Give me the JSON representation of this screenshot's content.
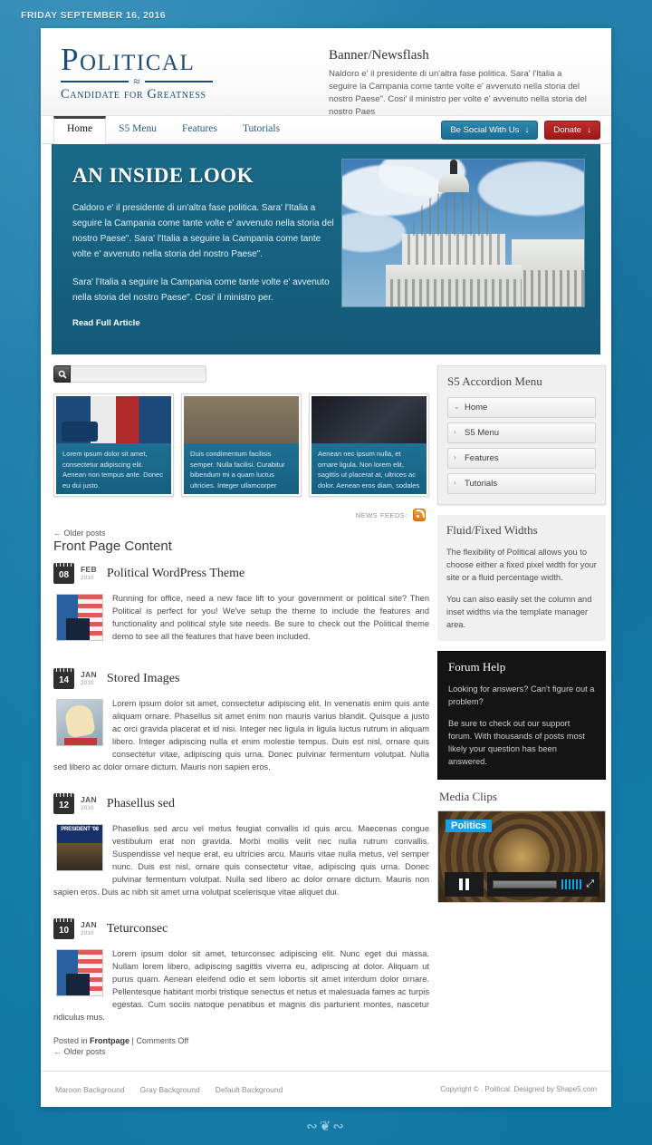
{
  "topbar": {
    "date": "FRIDAY SEPTEMBER 16, 2016"
  },
  "header": {
    "logo_main": "Political",
    "logo_sub": "Candidate for Greatness",
    "newsflash_title": "Banner/Newsflash",
    "newsflash_text": "Naldoro e' il presidente di un'altra fase politica. Sara' l'Italia a seguire la Campania come tante volte e' avvenuto nella storia del nostro Paese\". Cosi' il ministro per volte e' avvenuto nella storia del nostro Paes"
  },
  "nav": {
    "items": [
      {
        "label": "Home",
        "active": true
      },
      {
        "label": "S5 Menu",
        "active": false
      },
      {
        "label": "Features",
        "active": false
      },
      {
        "label": "Tutorials",
        "active": false
      }
    ],
    "social_button": "Be Social With Us",
    "donate_button": "Donate",
    "arrow_glyph": "↓"
  },
  "hero": {
    "title": "AN INSIDE LOOK",
    "paragraph1": "Caldoro e' il presidente di un'altra fase politica. Sara' l'Italia a seguire la Campania come tante volte e' avvenuto nella storia del nostro Paese\". Sara' l'Italia a seguire la Campania come tante volte e' avvenuto nella storia del nostro Paese\".",
    "paragraph2": "Sara' l'Italia a seguire la Campania come tante volte e' avvenuto nella storia del nostro Paese\". Cosi' il ministro per.",
    "link": "Read Full Article",
    "image_alt": "us-capitol-dome-photo"
  },
  "search": {
    "placeholder": "",
    "value": "",
    "icon": "search-icon"
  },
  "cards": [
    {
      "caption": "Lorem ipsum dolor sit amet, consectetur adipiscing elit. Aenean non tempus ante. Donec eu dui justo.",
      "image_alt": "press-conference-photo"
    },
    {
      "caption": "Duis condimentum facilisis semper. Nulla facilisi. Curabitur bibendum mi a quam luctus ultricies. Integer ullamcorper",
      "image_alt": "two-diplomats-photo"
    },
    {
      "caption": "Aenean nec ipsum nulla, et ornare ligula. Non lorem elit, sagittis ut placerat at, ultrices ac dolor. Aenean eros diam, sodales eu",
      "image_alt": "politician-press-scrum-photo"
    }
  ],
  "main": {
    "feeds_label": "NEWS FEEDS:",
    "older_posts_top": "← Older posts",
    "front_page_title": "Front Page Content",
    "posts": [
      {
        "day": "08",
        "month": "FEB",
        "year": "2010",
        "title": "Political WordPress Theme",
        "thumb_alt": "speaker-at-podium-photo",
        "text": "Running for office, need a new face lift to your government or political site? Then Political is perfect for you! We've setup the theme to include the features and functionality and political style site needs. Be sure to check out the Political theme demo to see all the features that have been included."
      },
      {
        "day": "14",
        "month": "JAN",
        "year": "2010",
        "title": "Stored Images",
        "thumb_alt": "illustrated-face-photo",
        "text": "Lorem ipsum dolor sit amet, consectetur adipiscing elit. In venenatis enim quis ante aliquam ornare. Phasellus sit amet enim non mauris varius blandit. Quisque a justo ac orci gravida placerat et id nisi. Integer nec ligula in ligula luctus rutrum in aliquam libero. Integer adipiscing nulla et enim molestie tempus. Duis est nisl, ornare quis consectetur vitae, adipiscing quis urna. Donec pulvinar fermentum volutpat. Nulla sed libero ac dolor ornare dictum. Mauris non sapien eros."
      },
      {
        "day": "12",
        "month": "JAN",
        "year": "2010",
        "title": "Phasellus sed",
        "thumb_alt": "president-08-sign-photo",
        "text": "Phasellus sed arcu vel metus feugiat convallis id quis arcu. Maecenas congue vestibulum erat non gravida. Morbi mollis velit nec nulla rutrum convallis. Suspendisse vel neque erat, eu ultricies arcu. Mauris vitae nulla metus, vel semper nunc. Duis est nisl, ornare quis consectetur vitae, adipiscing quis urna. Donec pulvinar fermentum volutpat. Nulla sed libero ac dolor ornare dictum. Mauris non sapien eros. Duis ac nibh sit amet urna volutpat scelerisque vitae aliquet dui."
      },
      {
        "day": "10",
        "month": "JAN",
        "year": "2010",
        "title": "Teturconsec",
        "thumb_alt": "speaker-at-podium-photo",
        "text": "Lorem ipsum dolor sit amet, teturconsec adipiscing elit. Nunc eget dui massa. Nullam lorem libero, adipiscing sagittis viverra eu, adipiscing at dolor. Aliquam ut purus quam. Aenean eleifend odio et sem lobortis sit amet interdum dolor ornare. Pellentesque habitant morbi tristique senectus et netus et malesuada fames ac turpis egestas. Cum sociis natoque penatibus et magnis dis parturient montes, nascetur ridiculus mus."
      }
    ],
    "posted_in_prefix": "Posted in ",
    "posted_in_category": "Frontpage",
    "posted_in_comments": " | Comments Off",
    "older_posts_bottom": "← Older posts"
  },
  "sidebar": {
    "accordion": {
      "title": "S5 Accordion Menu",
      "items": [
        {
          "label": "Home",
          "chevron": "⌄",
          "open": true
        },
        {
          "label": "S5 Menu",
          "chevron": "›",
          "open": false
        },
        {
          "label": "Features",
          "chevron": "›",
          "open": false
        },
        {
          "label": "Tutorials",
          "chevron": "›",
          "open": false
        }
      ]
    },
    "fluid": {
      "title": "Fluid/Fixed Widths",
      "p1": "The flexibility of Political allows you to choose either a fixed pixel width for your site or a fluid percentage width.",
      "p2": "You can also easily set the column and inset widths via the template manager area."
    },
    "forum": {
      "title": "Forum Help",
      "p1": "Looking for answers? Can't figure out a problem?",
      "p2": "Be sure to check out our support forum. With thousands of posts most likely your question has been answered."
    },
    "media": {
      "title": "Media Clips",
      "tag": "Politics",
      "image_alt": "capitol-rotunda-ceiling-photo",
      "play_state": "pause"
    }
  },
  "footer": {
    "links": [
      "Maroon Background",
      "Gray Background",
      "Default Background"
    ],
    "copyright": "Copyright © . Political. Designed by Shape5.com"
  },
  "colors": {
    "page_bg": "#1579a8",
    "hero_bg": "#15617f",
    "brand_navy": "#1d4c75",
    "social_btn": "#1a6d95",
    "donate_btn": "#a01717",
    "accent_cyan": "#14a3e0",
    "rss_orange": "#e2750c"
  }
}
